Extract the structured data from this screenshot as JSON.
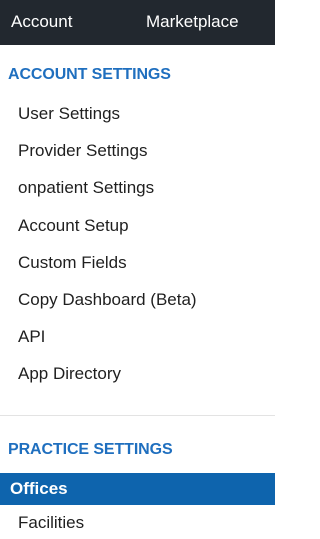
{
  "topnav": {
    "account_label": "Account",
    "marketplace_label": "Marketplace"
  },
  "account_settings": {
    "header": "ACCOUNT SETTINGS",
    "items": [
      {
        "label": "User Settings"
      },
      {
        "label": "Provider Settings"
      },
      {
        "label": "onpatient Settings"
      },
      {
        "label": "Account Setup"
      },
      {
        "label": "Custom Fields"
      },
      {
        "label": "Copy Dashboard (Beta)"
      },
      {
        "label": "API"
      },
      {
        "label": "App Directory"
      }
    ]
  },
  "practice_settings": {
    "header": "PRACTICE SETTINGS",
    "items": [
      {
        "label": "Offices",
        "active": true
      },
      {
        "label": "Facilities"
      }
    ]
  },
  "colors": {
    "topbar_bg": "#22282f",
    "section_header": "#1f6fbf",
    "active_bg": "#0e64ad"
  }
}
